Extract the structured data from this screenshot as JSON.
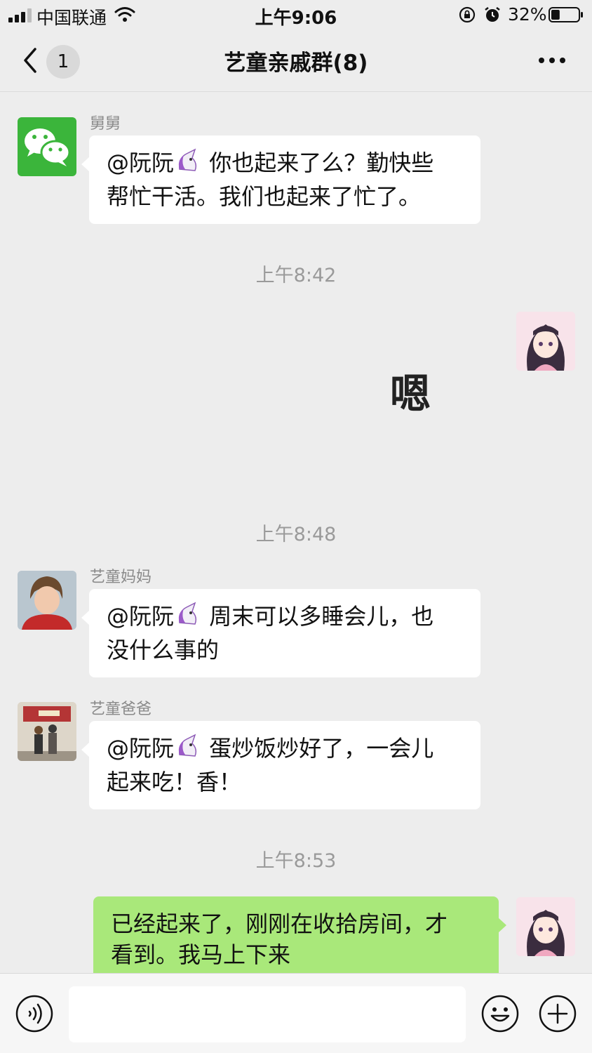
{
  "status_bar": {
    "carrier": "中国联通",
    "time": "上午9:06",
    "battery_percent": "32%",
    "battery_level": 0.32
  },
  "header": {
    "unread_count": "1",
    "title": "艺童亲戚群(8)"
  },
  "messages": [
    {
      "sender": "舅舅",
      "text_before": "@阮阮",
      "emoji": "unicorn-emoji",
      "text_line1_rest": " 你也起来了么？勤快些",
      "text_line2": "帮忙干活。我们也起来了忙了。"
    },
    {
      "timestamp": "上午8:42"
    },
    {
      "sticker": "嗯"
    },
    {
      "timestamp": "上午8:48"
    },
    {
      "sender": "艺童妈妈",
      "text_before": "@阮阮",
      "emoji": "unicorn-emoji",
      "text_line1_rest": " 周末可以多睡会儿，也",
      "text_line2": "没什么事的"
    },
    {
      "sender": "艺童爸爸",
      "text_before": "@阮阮",
      "emoji": "unicorn-emoji",
      "text_line1_rest": " 蛋炒饭炒好了，一会儿",
      "text_line2": "起来吃！香！"
    },
    {
      "timestamp": "上午8:53"
    },
    {
      "mine": true,
      "text_line1": "已经起来了，刚刚在收拾房间，才",
      "text_line2": "看到。我马上下来"
    }
  ],
  "input": {
    "placeholder": ""
  },
  "colors": {
    "background": "#ededed",
    "my_bubble": "#a9e87a",
    "other_bubble": "#ffffff",
    "wechat_green": "#3bb53b"
  },
  "icons": [
    "signal-icon",
    "wifi-icon",
    "rotation-lock-icon",
    "alarm-icon",
    "battery-icon",
    "back-chevron-icon",
    "more-icon",
    "voice-icon",
    "emoji-icon",
    "plus-icon"
  ]
}
